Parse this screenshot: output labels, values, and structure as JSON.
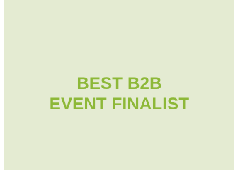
{
  "card": {
    "background": "#e4ebd2",
    "text_color": "#8db838",
    "line1": "BEST B2B",
    "line2": "EVENT FINALIST"
  }
}
